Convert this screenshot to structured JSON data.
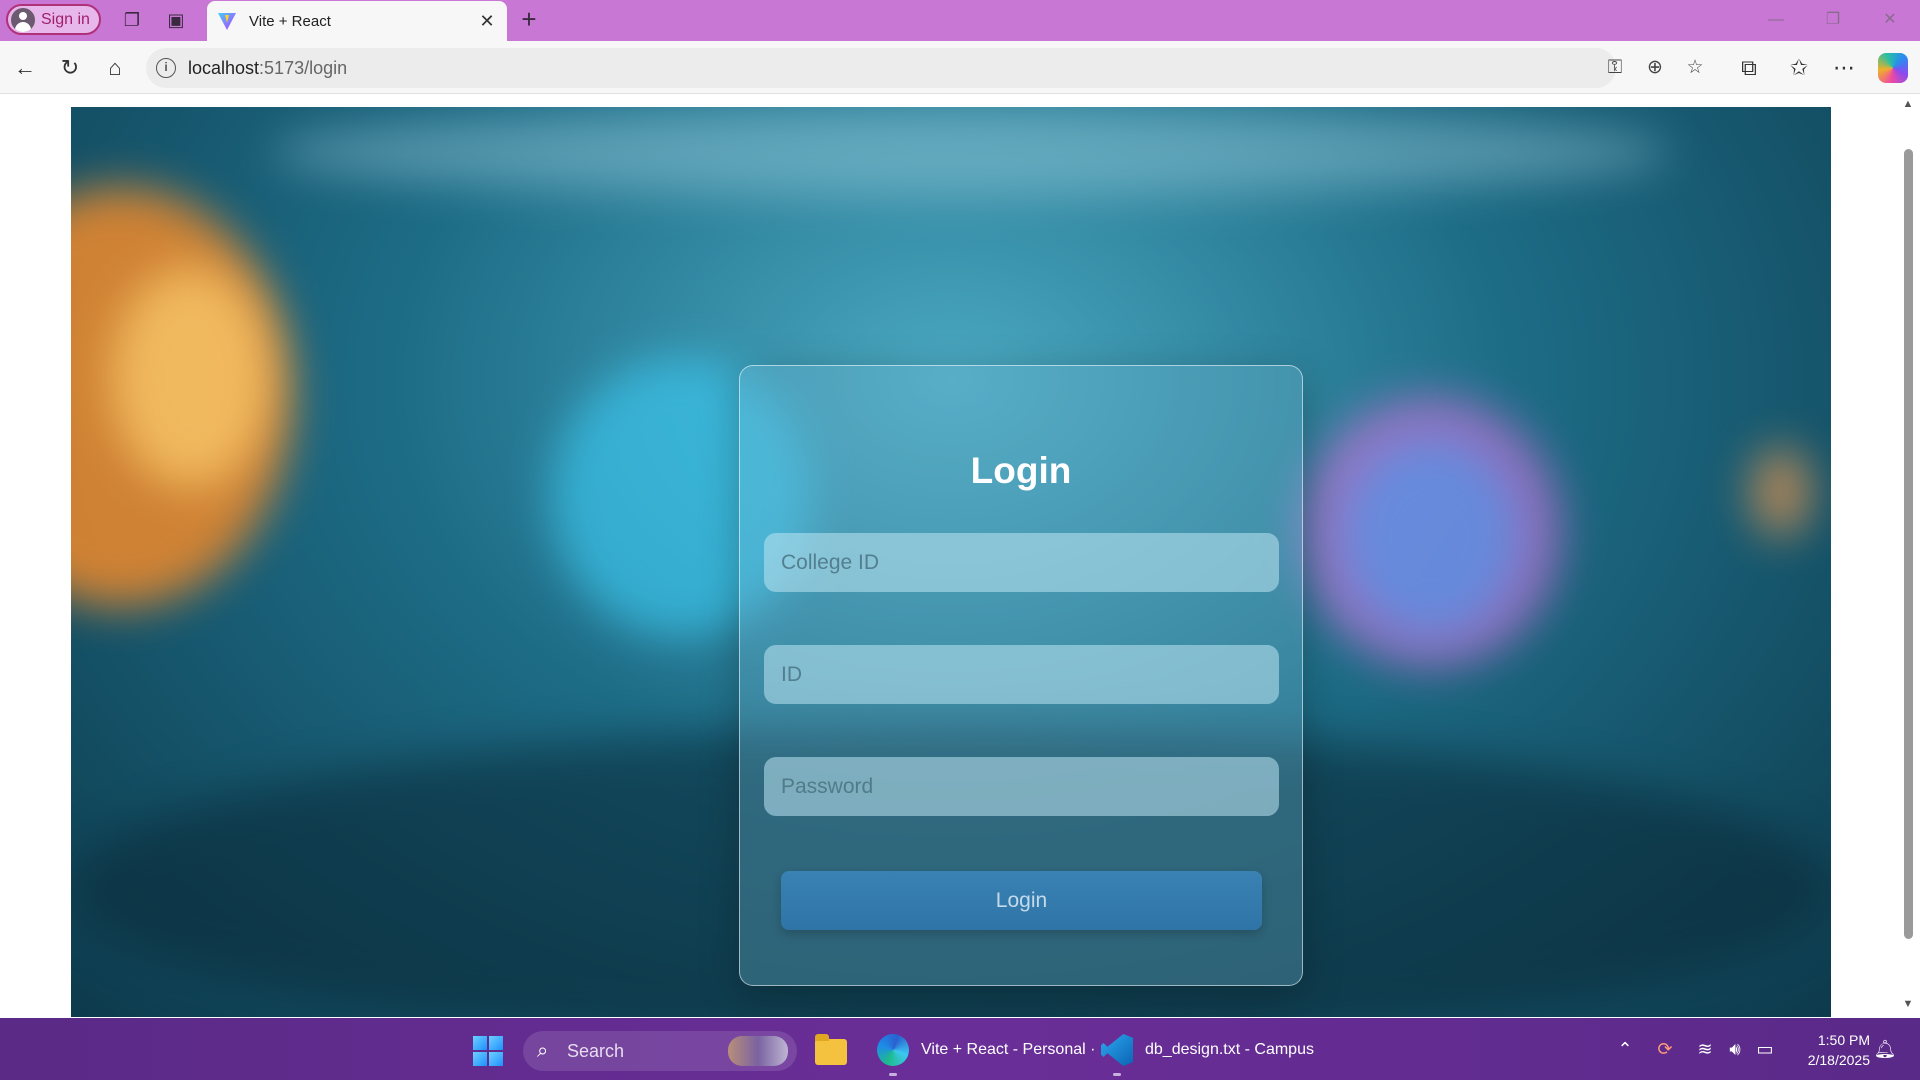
{
  "browser": {
    "signin_label": "Sign in",
    "tab_title": "Vite + React",
    "url_host": "localhost",
    "url_rest": ":5173/login"
  },
  "login": {
    "heading": "Login",
    "college_id_placeholder": "College ID",
    "id_placeholder": "ID",
    "password_placeholder": "Password",
    "button_label": "Login"
  },
  "taskbar": {
    "search_label": "Search",
    "apps": [
      {
        "label": "Vite + React - Personal ·"
      },
      {
        "label": "db_design.txt - Campus"
      }
    ],
    "time": "1:50 PM",
    "date": "2/18/2025"
  },
  "colors": {
    "tabstrip": "#c878d4",
    "taskbar": "#6a2e98",
    "login_button": "#3a82b4"
  }
}
